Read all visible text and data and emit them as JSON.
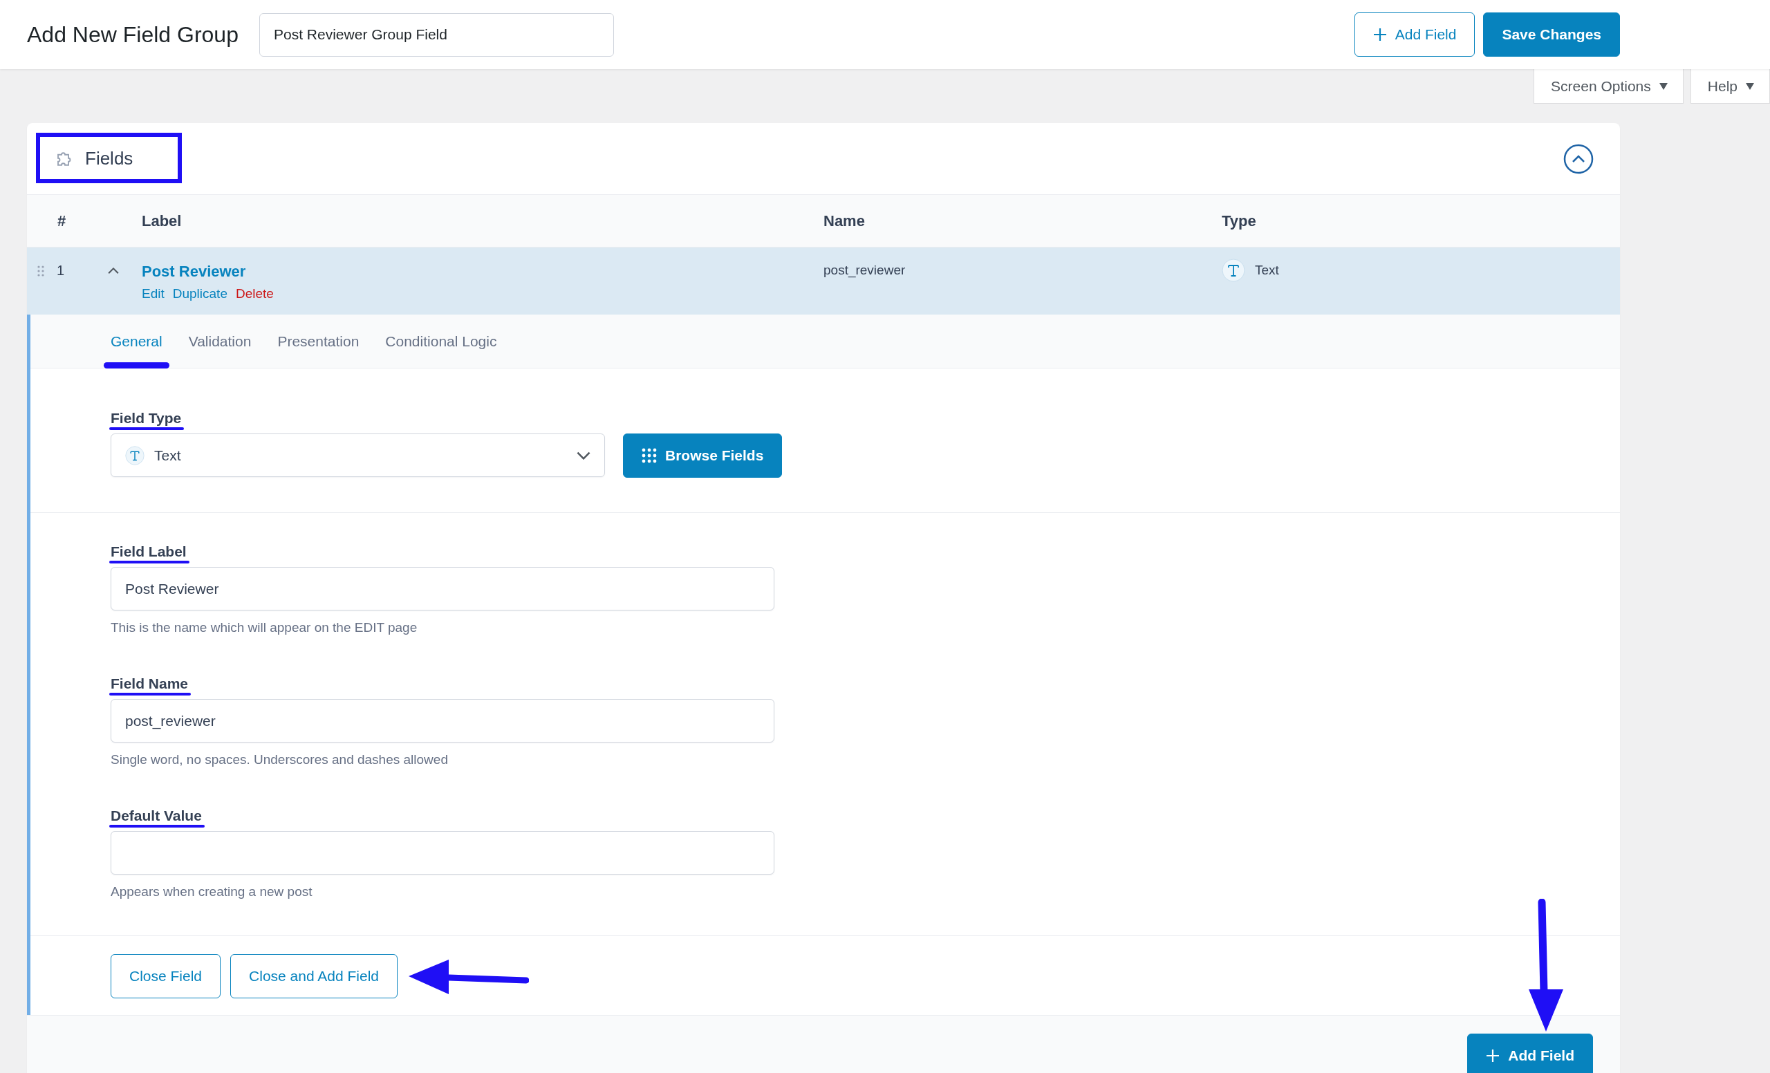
{
  "header": {
    "title": "Add New Field Group",
    "group_name": "Post Reviewer Group Field",
    "buttons": [
      {
        "label": "Add Field",
        "kind": "outline"
      },
      {
        "label": "Save Changes",
        "kind": "primary"
      }
    ]
  },
  "screen_meta": [
    {
      "label": "Screen Options"
    },
    {
      "label": "Help"
    }
  ],
  "panel": {
    "title": "Fields",
    "expanded": true
  },
  "table": {
    "columns": [
      "#",
      "Label",
      "Name",
      "Type"
    ],
    "rows": [
      {
        "number": "1",
        "label": "Post Reviewer",
        "actions": [
          {
            "label": "Edit",
            "kind": "normal"
          },
          {
            "label": "Duplicate",
            "kind": "normal"
          },
          {
            "label": "Delete",
            "kind": "danger"
          }
        ],
        "name": "post_reviewer",
        "type": "Text",
        "expanded": true
      }
    ]
  },
  "field_editor": {
    "tabs": [
      {
        "label": "General",
        "selected": true
      },
      {
        "label": "Validation",
        "selected": false
      },
      {
        "label": "Presentation",
        "selected": false
      },
      {
        "label": "Conditional Logic",
        "selected": false
      }
    ],
    "field_type": {
      "label": "Field Type",
      "value": "Text",
      "browse_button": "Browse Fields"
    },
    "settings": [
      {
        "label": "Field Label",
        "value": "Post Reviewer",
        "help": "This is the name which will appear on the EDIT page"
      },
      {
        "label": "Field Name",
        "value": "post_reviewer",
        "help": "Single word, no spaces. Underscores and dashes allowed"
      },
      {
        "label": "Default Value",
        "help": "Appears when creating a new post"
      }
    ],
    "actions": [
      "Close Field",
      "Close and Add Field"
    ]
  },
  "footer": {
    "button": "Add Field"
  }
}
